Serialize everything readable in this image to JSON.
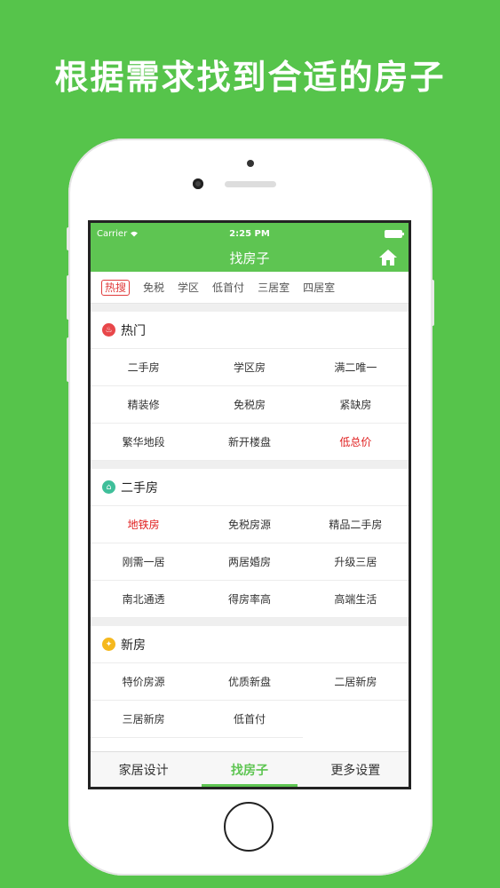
{
  "headline": "根据需求找到合适的房子",
  "status_bar": {
    "carrier": "Carrier",
    "time": "2:25 PM"
  },
  "nav": {
    "title": "找房子"
  },
  "filter_tabs": [
    "热搜",
    "免税",
    "学区",
    "低首付",
    "三居室",
    "四居室"
  ],
  "sections": [
    {
      "title": "热门",
      "icon": "flame-icon",
      "icon_color": "#e8474a",
      "items": [
        {
          "label": "二手房",
          "highlight": false
        },
        {
          "label": "学区房",
          "highlight": false
        },
        {
          "label": "满二唯一",
          "highlight": false
        },
        {
          "label": "精装修",
          "highlight": false
        },
        {
          "label": "免税房",
          "highlight": false
        },
        {
          "label": "紧缺房",
          "highlight": false
        },
        {
          "label": "繁华地段",
          "highlight": false
        },
        {
          "label": "新开楼盘",
          "highlight": false
        },
        {
          "label": "低总价",
          "highlight": true
        }
      ]
    },
    {
      "title": "二手房",
      "icon": "house-icon",
      "icon_color": "#3fbf9a",
      "items": [
        {
          "label": "地铁房",
          "highlight": true
        },
        {
          "label": "免税房源",
          "highlight": false
        },
        {
          "label": "精品二手房",
          "highlight": false
        },
        {
          "label": "刚需一居",
          "highlight": false
        },
        {
          "label": "两居婚房",
          "highlight": false
        },
        {
          "label": "升级三居",
          "highlight": false
        },
        {
          "label": "南北通透",
          "highlight": false
        },
        {
          "label": "得房率高",
          "highlight": false
        },
        {
          "label": "高端生活",
          "highlight": false
        }
      ]
    },
    {
      "title": "新房",
      "icon": "fire-icon",
      "icon_color": "#f5b81e",
      "items": [
        {
          "label": "特价房源",
          "highlight": false
        },
        {
          "label": "优质新盘",
          "highlight": false
        },
        {
          "label": "二居新房",
          "highlight": false
        },
        {
          "label": "三居新房",
          "highlight": false
        },
        {
          "label": "低首付",
          "highlight": false
        }
      ]
    }
  ],
  "tab_bar": [
    {
      "label": "家居设计",
      "active": false
    },
    {
      "label": "找房子",
      "active": true
    },
    {
      "label": "更多设置",
      "active": false
    }
  ],
  "colors": {
    "brand_green": "#5ec552",
    "background_green": "#56c44b",
    "highlight_red": "#e02020"
  }
}
